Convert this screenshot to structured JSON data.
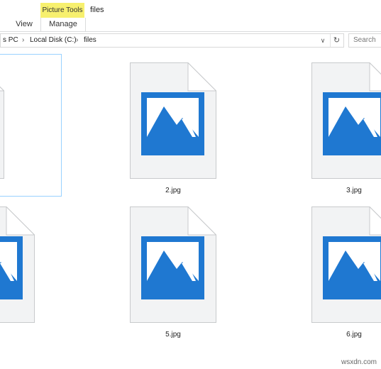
{
  "ribbon": {
    "context_group": "Picture Tools",
    "tabs": [
      {
        "label": "View"
      },
      {
        "label": "Manage"
      }
    ],
    "window_title": "files"
  },
  "address": {
    "crumbs": [
      "s PC",
      "Local Disk (C:)",
      "files"
    ],
    "dropdown_icon": "chevron-down-icon",
    "refresh_icon": "refresh-icon"
  },
  "search": {
    "placeholder": "Search"
  },
  "files": [
    {
      "name": "",
      "selected": true
    },
    {
      "name": "2.jpg",
      "selected": false
    },
    {
      "name": "3.jpg",
      "selected": false
    },
    {
      "name": "",
      "selected": false
    },
    {
      "name": "5.jpg",
      "selected": false
    },
    {
      "name": "6.jpg",
      "selected": false
    }
  ],
  "watermark": "wsxdn.com",
  "colors": {
    "image_blue": "#1f78d1",
    "context_yellow": "#f7f06e",
    "selection": "#99d1ff"
  }
}
